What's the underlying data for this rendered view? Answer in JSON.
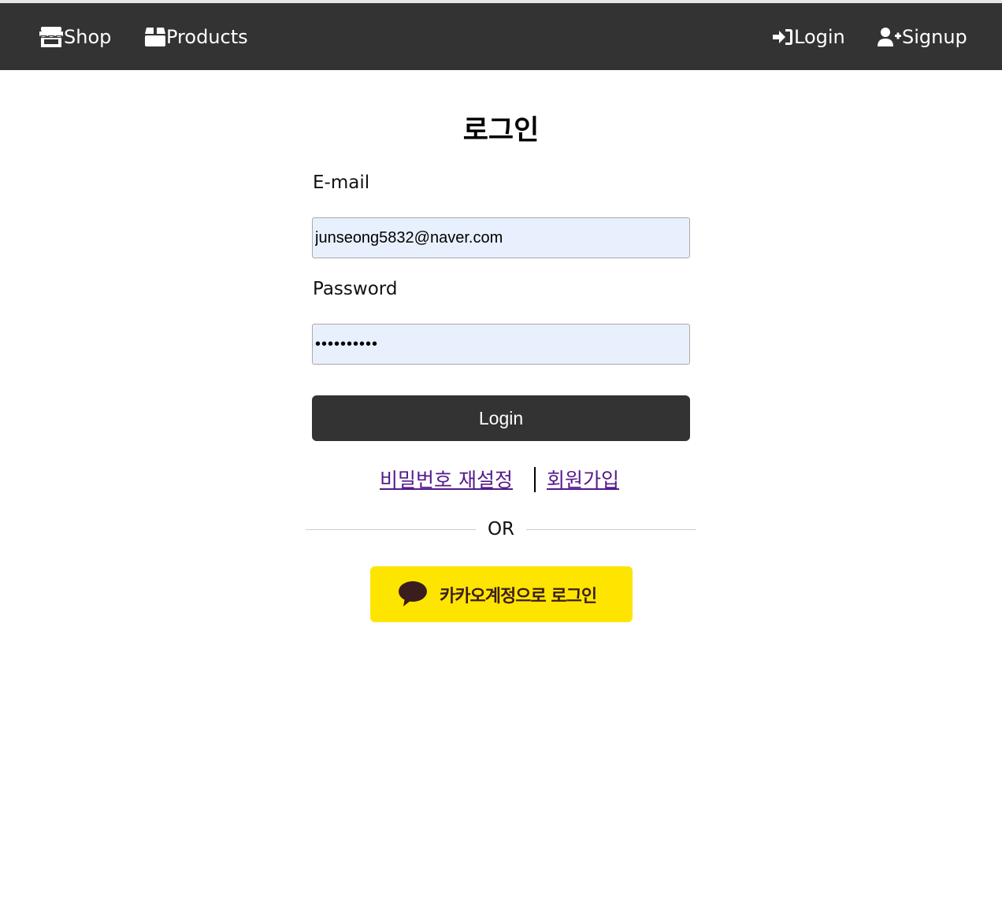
{
  "navbar": {
    "shop_label": "Shop",
    "products_label": "Products",
    "login_label": "Login",
    "signup_label": "Signup",
    "icons": {
      "shop": "store-icon",
      "products": "box-icon",
      "login": "sign-in-icon",
      "signup": "user-plus-icon"
    },
    "background_color": "#333333"
  },
  "form": {
    "title": "로그인",
    "email_label": "E-mail",
    "email_value": "junseong5832@naver.com",
    "password_label": "Password",
    "password_value": "••••••••••",
    "login_button": "Login",
    "reset_password_link": "비밀번호 재설정",
    "signup_link": "회원가입",
    "divider_text": "OR",
    "kakao_button": "카카오계정으로 로그인",
    "kakao_icon": "speech-bubble-icon",
    "kakao_color": "#fee500",
    "field_background": "#e8f0fe"
  }
}
